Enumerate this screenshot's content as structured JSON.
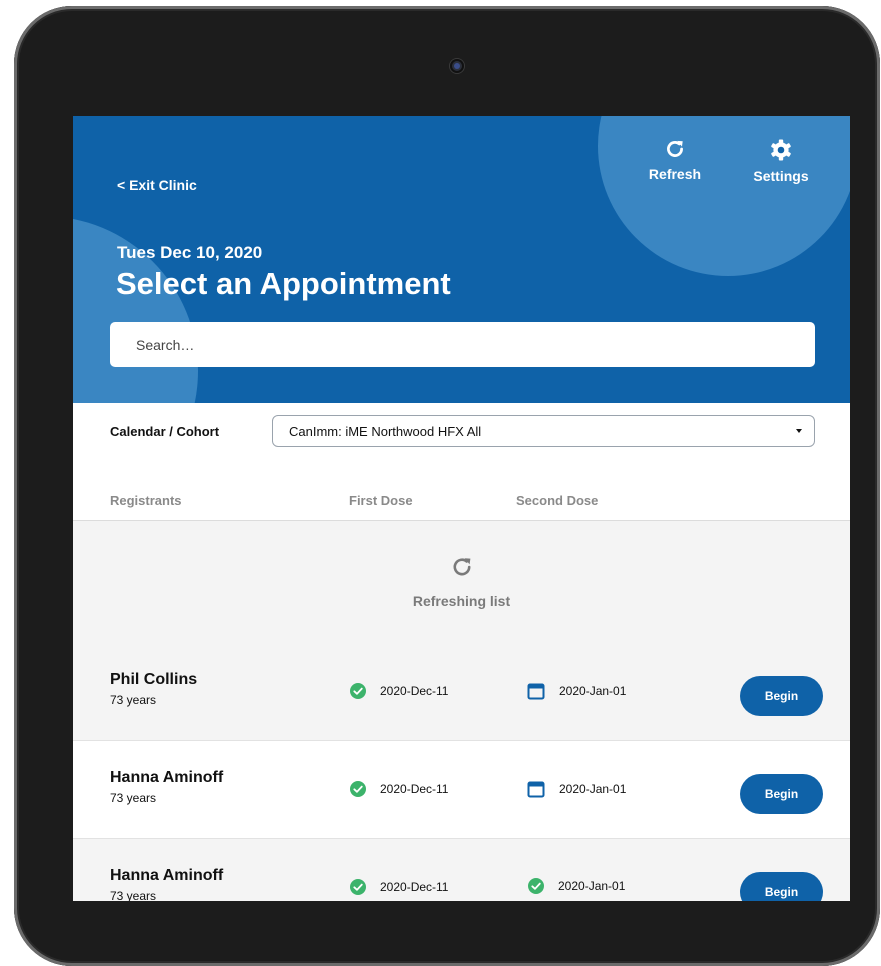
{
  "header": {
    "exit_label": "< Exit Clinic",
    "refresh_label": "Refresh",
    "settings_label": "Settings",
    "date": "Tues Dec 10, 2020",
    "title": "Select an Appointment"
  },
  "search": {
    "placeholder": "Search…"
  },
  "filter": {
    "label": "Calendar / Cohort",
    "selected": "CanImm: iME Northwood HFX All"
  },
  "columns": {
    "registrants": "Registrants",
    "first_dose": "First Dose",
    "second_dose": "Second Dose"
  },
  "status": {
    "refreshing": "Refreshing list"
  },
  "rows": [
    {
      "name": "Phil Collins",
      "age": "73 years",
      "first_dose": "2020-Dec-11",
      "first_dose_status": "check-icon",
      "second_dose": "2020-Jan-01",
      "second_dose_status": "calendar-icon",
      "button": "Begin"
    },
    {
      "name": "Hanna Aminoff",
      "age": "73 years",
      "first_dose": "2020-Dec-11",
      "first_dose_status": "check-icon",
      "second_dose": "2020-Jan-01",
      "second_dose_status": "calendar-icon",
      "button": "Begin"
    },
    {
      "name": "Hanna Aminoff",
      "age": "73 years",
      "first_dose": "2020-Dec-11",
      "first_dose_status": "check-icon",
      "second_dose": "2020-Jan-01",
      "second_dose_status": "check-icon",
      "button": "Begin"
    }
  ],
  "colors": {
    "primary": "#0f62a8",
    "accent_circle": "#3a86c2",
    "success": "#3cb36b",
    "list_background": "#f4f4f4"
  }
}
